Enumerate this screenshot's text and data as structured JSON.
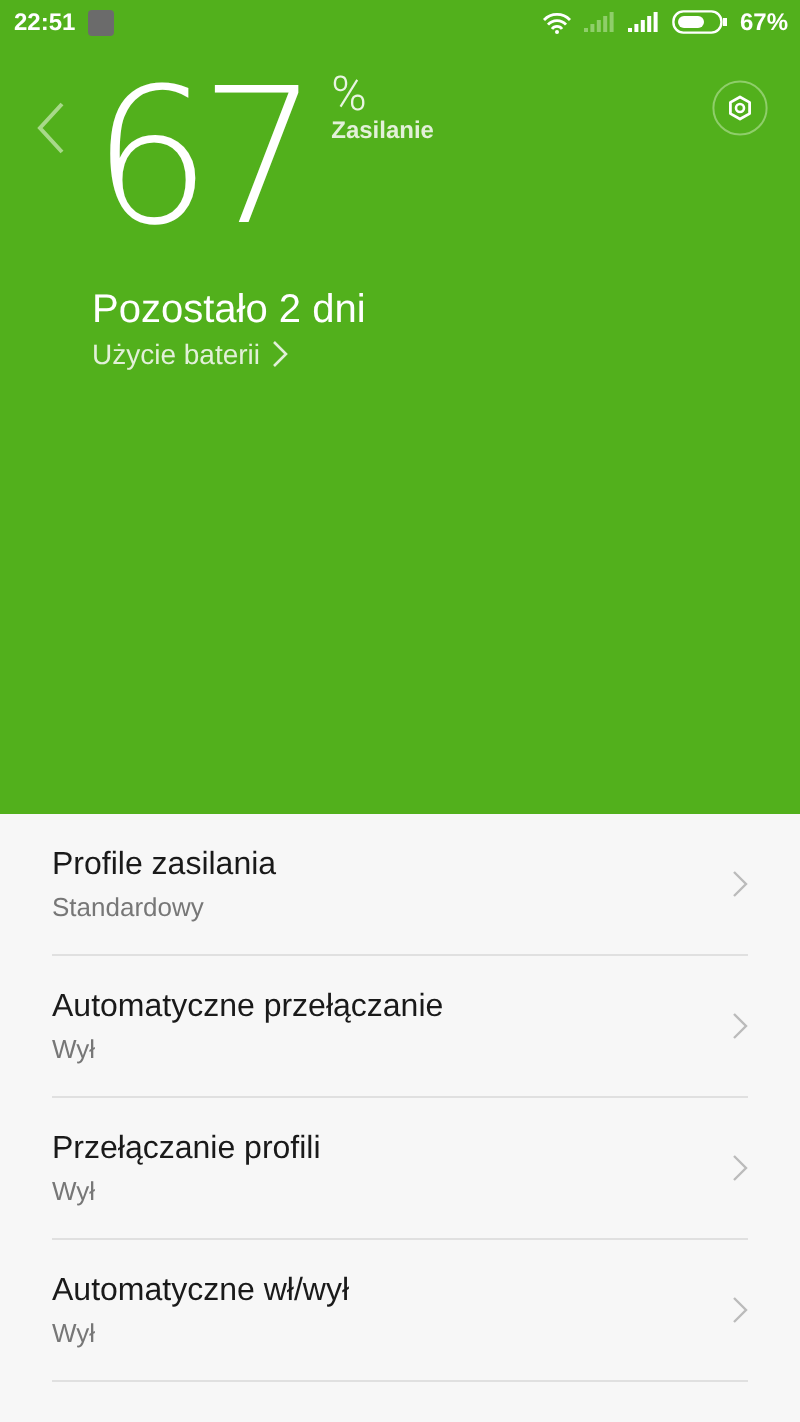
{
  "status_bar": {
    "time": "22:51",
    "battery_percent": "67%"
  },
  "header": {
    "percent_value": "67",
    "percent_sign": "%",
    "mode_label": "Zasilanie",
    "remaining": "Pozostało 2 dni",
    "usage_link": "Użycie baterii"
  },
  "settings": [
    {
      "title": "Profile zasilania",
      "value": "Standardowy"
    },
    {
      "title": "Automatyczne przełączanie",
      "value": "Wył"
    },
    {
      "title": "Przełączanie profili",
      "value": "Wył"
    },
    {
      "title": "Automatyczne wł/wył",
      "value": "Wył"
    }
  ]
}
